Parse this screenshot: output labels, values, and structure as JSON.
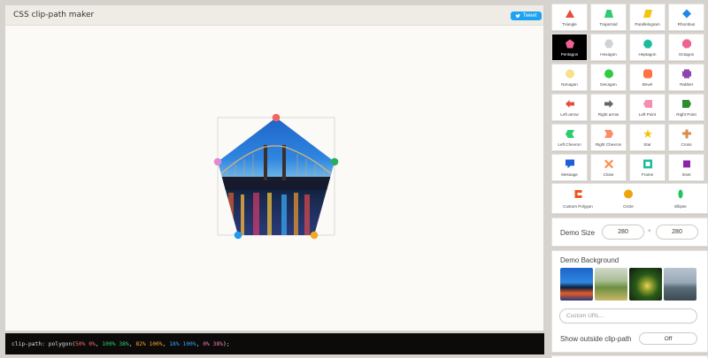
{
  "header": {
    "title": "CSS clip-path maker",
    "tweet_label": "Tweet"
  },
  "code": {
    "prefix": "clip-path: polygon(",
    "points": [
      {
        "text": "50% 0%",
        "color": "#ff6b6b"
      },
      {
        "text": "100% 38%",
        "color": "#2bd47a"
      },
      {
        "text": "82% 100%",
        "color": "#ffa62b"
      },
      {
        "text": "18% 100%",
        "color": "#32a8ff"
      },
      {
        "text": "0% 38%",
        "color": "#ff7ab5"
      }
    ],
    "suffix": ");"
  },
  "shapes": [
    {
      "label": "Triangle",
      "icon": "triangle-icon",
      "color": "#e74c3c"
    },
    {
      "label": "Trapezoid",
      "icon": "trapezoid-icon",
      "color": "#2ecc71"
    },
    {
      "label": "Parallelogram",
      "icon": "parallelogram-icon",
      "color": "#f1c40f"
    },
    {
      "label": "Rhombus",
      "icon": "rhombus-icon",
      "color": "#1e88e5"
    },
    {
      "label": "Pentagon",
      "icon": "pentagon-icon",
      "color": "#f06292"
    },
    {
      "label": "Hexagon",
      "icon": "hexagon-icon",
      "color": "#cfd2d6"
    },
    {
      "label": "Heptagon",
      "icon": "heptagon-icon",
      "color": "#1abc9c"
    },
    {
      "label": "Octagon",
      "icon": "octagon-icon",
      "color": "#f06292"
    },
    {
      "label": "Nonagon",
      "icon": "nonagon-icon",
      "color": "#f7e08a"
    },
    {
      "label": "Decagon",
      "icon": "decagon-icon",
      "color": "#2ecc40"
    },
    {
      "label": "Bevel",
      "icon": "bevel-icon",
      "color": "#ff7043"
    },
    {
      "label": "Rabbet",
      "icon": "rabbet-icon",
      "color": "#8e44ad"
    },
    {
      "label": "Left arrow",
      "icon": "left-arrow-icon",
      "color": "#e74c3c"
    },
    {
      "label": "Right arrow",
      "icon": "right-arrow-icon",
      "color": "#666666"
    },
    {
      "label": "Left Point",
      "icon": "left-point-icon",
      "color": "#f48fb1"
    },
    {
      "label": "Right Point",
      "icon": "right-point-icon",
      "color": "#2e8b2e"
    },
    {
      "label": "Left Chevron",
      "icon": "left-chevron-icon",
      "color": "#2ecc71"
    },
    {
      "label": "Right Chevron",
      "icon": "right-chevron-icon",
      "color": "#ff8a65"
    },
    {
      "label": "Star",
      "icon": "star-icon",
      "color": "#f1c40f"
    },
    {
      "label": "Cross",
      "icon": "cross-icon",
      "color": "#d98b4a"
    },
    {
      "label": "Message",
      "icon": "message-icon",
      "color": "#1e5fd6"
    },
    {
      "label": "Close",
      "icon": "close-icon",
      "color": "#ff8a4a"
    },
    {
      "label": "Frame",
      "icon": "frame-icon",
      "color": "#1abc9c"
    },
    {
      "label": "Inset",
      "icon": "inset-icon",
      "color": "#8e24aa"
    }
  ],
  "extra_shapes": [
    {
      "label": "Custom Polygon",
      "icon": "custom-polygon-icon",
      "color": "#f4511e"
    },
    {
      "label": "Circle",
      "icon": "circle-icon",
      "color": "#f0a30a"
    },
    {
      "label": "Ellipse",
      "icon": "ellipse-icon",
      "color": "#22c55e"
    }
  ],
  "selected_shape": "Pentagon",
  "demo_size": {
    "label": "Demo Size",
    "width": "280",
    "separator": "×",
    "height": "280"
  },
  "demo_background": {
    "label": "Demo Background",
    "custom_url_placeholder": "Custom URL..."
  },
  "show_outside": {
    "label": "Show outside clip-path",
    "value": "Off"
  },
  "handle_colors": [
    "#f0655d",
    "#27ae60",
    "#f5a623",
    "#1e9bf0",
    "#e588d4"
  ],
  "accent": "#1da1f2"
}
